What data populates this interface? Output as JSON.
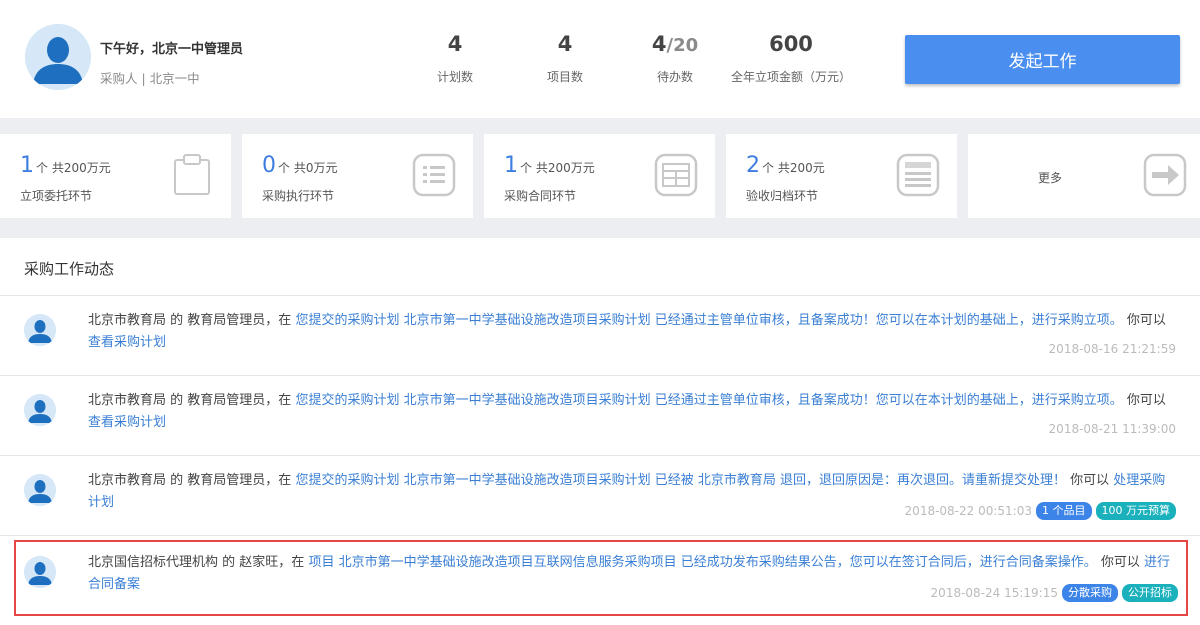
{
  "user": {
    "greeting": "下午好，北京一中管理员",
    "role": "采购人 | 北京一中"
  },
  "stats": [
    {
      "value": "4",
      "label": "计划数"
    },
    {
      "value": "4",
      "label": "项目数"
    },
    {
      "value": "4",
      "total": "/20",
      "label": "待办数"
    },
    {
      "value": "600",
      "label": "全年立项金额（万元）"
    }
  ],
  "start_button": "发起工作",
  "cards": [
    {
      "count": "1",
      "suffix": "个 共200万元",
      "label": "立项委托环节",
      "icon": "clipboard-icon"
    },
    {
      "count": "0",
      "suffix": "个 共0万元",
      "label": "采购执行环节",
      "icon": "list-icon"
    },
    {
      "count": "1",
      "suffix": "个 共200万元",
      "label": "采购合同环节",
      "icon": "table-icon"
    },
    {
      "count": "2",
      "suffix": "个 共200元",
      "label": "验收归档环节",
      "icon": "archive-icon"
    }
  ],
  "more": "更多",
  "feed": {
    "title": "采购工作动态",
    "items": [
      {
        "org": "北京市教育局",
        "de": " 的 ",
        "person": "教育局管理员",
        "zai": "，在 ",
        "link1": "您提交的采购计划 北京市第一中学基础设施改造项目采购计划 已经通过主管单位审核，且备案成功！您可以在本计划的基础上，进行采购立项。",
        "mid": " 你可以 ",
        "link2": "查看采购计划",
        "time": "2018-08-16 21:21:59"
      },
      {
        "org": "北京市教育局",
        "de": " 的 ",
        "person": "教育局管理员",
        "zai": "，在 ",
        "link1": "您提交的采购计划 北京市第一中学基础设施改造项目采购计划 已经通过主管单位审核，且备案成功！您可以在本计划的基础上，进行采购立项。",
        "mid": " 你可以 ",
        "link2": "查看采购计划",
        "time": "2018-08-21 11:39:00"
      },
      {
        "org": "北京市教育局",
        "de": " 的 ",
        "person": "教育局管理员",
        "zai": "，在 ",
        "link1": "您提交的采购计划 北京市第一中学基础设施改造项目采购计划 已经被 北京市教育局 退回，退回原因是：再次退回。请重新提交处理！",
        "mid": " 你可以 ",
        "link2": "处理采购计划",
        "time": "2018-08-22 00:51:03",
        "tags": [
          "1 个品目",
          "100 万元预算"
        ]
      },
      {
        "org": "北京国信招标代理机构",
        "de": " 的 ",
        "person": "赵家旺",
        "zai": "，在 ",
        "link1": "项目 北京市第一中学基础设施改造项目互联网信息服务采购项目 已经成功发布采购结果公告，您可以在签订合同后，进行合同备案操作。",
        "mid": " 你可以 ",
        "link2": "进行合同备案",
        "time": "2018-08-24 15:19:15",
        "tags": [
          "分散采购",
          "公开招标"
        ]
      }
    ]
  },
  "colors": {
    "accent": "#4a8ff0",
    "link": "#3a7fd5",
    "tag_blue": "#3d84e8",
    "tag_teal": "#1ab0bc",
    "highlight": "#e84545"
  }
}
